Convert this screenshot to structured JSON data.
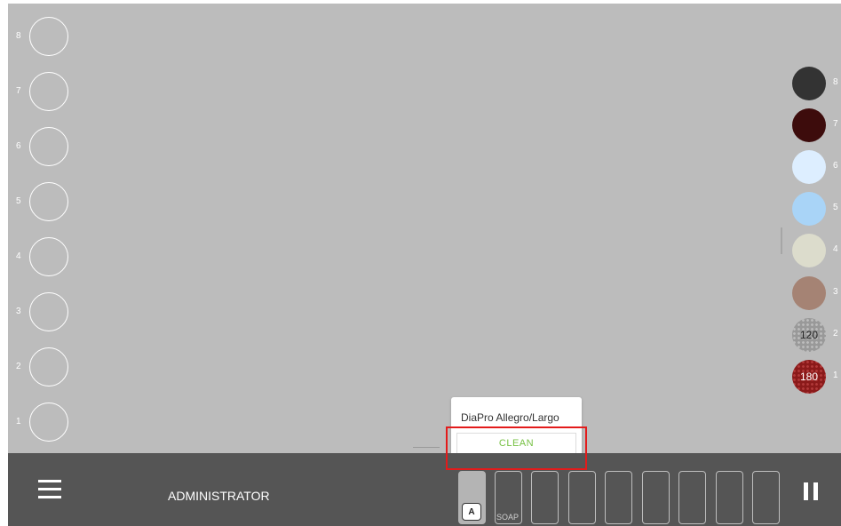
{
  "left_slots": [
    "8",
    "7",
    "6",
    "5",
    "4",
    "3",
    "2",
    "1"
  ],
  "right_swatches": [
    {
      "num": "8",
      "color": "#333333",
      "label": ""
    },
    {
      "num": "7",
      "color": "#3d0c0c",
      "label": ""
    },
    {
      "num": "6",
      "color": "#ddeeff",
      "label": ""
    },
    {
      "num": "5",
      "color": "#a9d4f7",
      "label": ""
    },
    {
      "num": "4",
      "color": "#dcdccc",
      "label": ""
    },
    {
      "num": "3",
      "color": "#a58374",
      "label": ""
    },
    {
      "num": "2",
      "color": "#999999",
      "label": "120",
      "pattern": "hex-grey"
    },
    {
      "num": "1",
      "color": "#8b1a1a",
      "label": "180",
      "pattern": "hex-red"
    }
  ],
  "popup": {
    "title": "DiaPro Allegro/Largo",
    "button_label": "CLEAN",
    "button_color": "#76c043"
  },
  "bottombar": {
    "menu_icon": "hamburger-menu-icon",
    "user": "ADMINISTRATOR",
    "pause_icon": "pause-icon",
    "trays": [
      {
        "badge": "A",
        "label": "",
        "active": true
      },
      {
        "badge": "",
        "label": "SOAP",
        "active": false
      },
      {
        "badge": "",
        "label": "",
        "active": false
      },
      {
        "badge": "",
        "label": "",
        "active": false
      },
      {
        "badge": "",
        "label": "",
        "active": false
      },
      {
        "badge": "",
        "label": "",
        "active": false
      },
      {
        "badge": "",
        "label": "",
        "active": false
      },
      {
        "badge": "",
        "label": "",
        "active": false
      },
      {
        "badge": "",
        "label": "",
        "active": false
      }
    ]
  },
  "colors": {
    "background": "#bcbcbc",
    "bar": "#555555",
    "highlight": "#e31b1b"
  }
}
